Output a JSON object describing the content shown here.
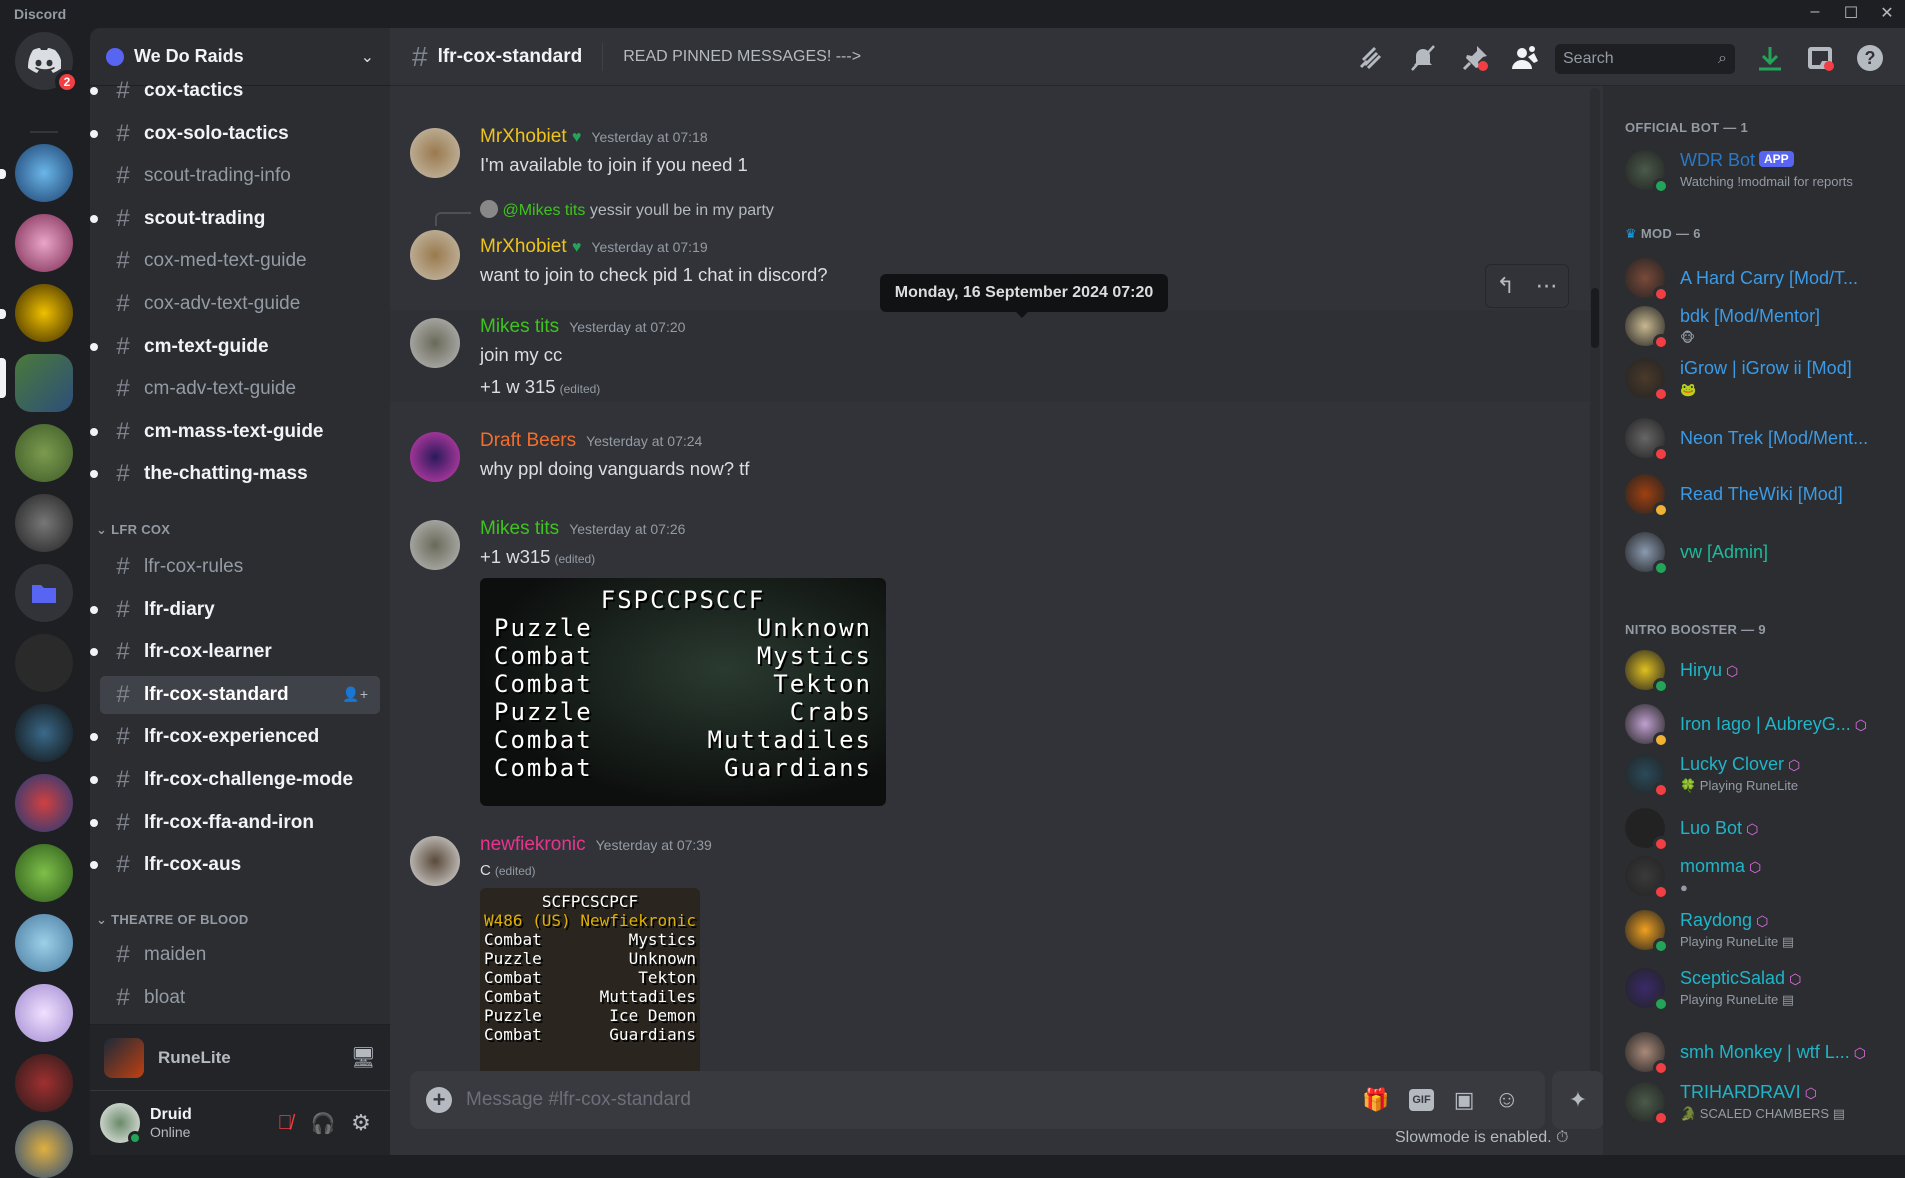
{
  "window": {
    "app_title": "Discord",
    "minimize": "–",
    "maximize": "☐",
    "close": "✕"
  },
  "rail": {
    "home_badge": "2"
  },
  "server": {
    "name": "We Do Raids"
  },
  "channels": [
    {
      "name": "cox-tactics",
      "state": "unread"
    },
    {
      "name": "cox-solo-tactics",
      "state": "unread"
    },
    {
      "name": "scout-trading-info",
      "state": "muted"
    },
    {
      "name": "scout-trading",
      "state": "unread"
    },
    {
      "name": "cox-med-text-guide",
      "state": "muted"
    },
    {
      "name": "cox-adv-text-guide",
      "state": "muted"
    },
    {
      "name": "cm-text-guide",
      "state": "unread"
    },
    {
      "name": "cm-adv-text-guide",
      "state": "muted"
    },
    {
      "name": "cm-mass-text-guide",
      "state": "unread"
    },
    {
      "name": "the-chatting-mass",
      "state": "unread"
    }
  ],
  "categories": {
    "lfr_cox": "LFR COX",
    "tob": "THEATRE OF BLOOD"
  },
  "lfr_channels": [
    {
      "name": "lfr-cox-rules"
    },
    {
      "name": "lfr-diary"
    },
    {
      "name": "lfr-cox-learner"
    },
    {
      "name": "lfr-cox-standard"
    },
    {
      "name": "lfr-cox-experienced"
    },
    {
      "name": "lfr-cox-challenge-mode"
    },
    {
      "name": "lfr-cox-ffa-and-iron"
    },
    {
      "name": "lfr-cox-aus"
    }
  ],
  "tob_channels": [
    {
      "name": "maiden"
    },
    {
      "name": "bloat"
    }
  ],
  "activity": {
    "name": "RuneLite"
  },
  "user": {
    "name": "Druid",
    "status": "Online"
  },
  "header": {
    "channel": "lfr-cox-standard",
    "topic": "READ PINNED MESSAGES! --->",
    "search_placeholder": "Search"
  },
  "messages": [
    {
      "author": "MrXhobiet",
      "color": "#f0c419",
      "time": "Yesterday at 07:18",
      "text": "I'm available to join if you need 1"
    },
    {
      "reply_to": "@Mikes tits",
      "reply_text": "yessir youll be in my party",
      "author": "MrXhobiet",
      "color": "#f0c419",
      "time": "Yesterday at 07:19",
      "text": "want to join to check pid 1 chat in discord?"
    },
    {
      "author": "Mikes tits",
      "color": "#3ec41c",
      "time": "Yesterday at 07:20",
      "text": "join my cc",
      "text2": "+1 w 315",
      "edited": "(edited)"
    },
    {
      "author": "Draft Beers",
      "color": "#f26f2b",
      "time": "Yesterday at 07:24",
      "text": "why ppl doing vanguards now? tf"
    },
    {
      "author": "Mikes tits",
      "color": "#3ec41c",
      "time": "Yesterday at 07:26",
      "text": "+1 w315",
      "edited": "(edited)"
    },
    {
      "author": "newfiekronic",
      "color": "#e9348f",
      "time": "Yesterday at 07:39",
      "text": "C",
      "edited": "(edited)"
    }
  ],
  "tooltip": "Monday, 16 September 2024 07:20",
  "scout1": {
    "title": "FSPCCPSCCF",
    "rows": [
      [
        "Puzzle",
        "Unknown"
      ],
      [
        "Combat",
        "Mystics"
      ],
      [
        "Combat",
        "Tekton"
      ],
      [
        "Puzzle",
        "Crabs"
      ],
      [
        "Combat",
        "Muttadiles"
      ],
      [
        "Combat",
        "Guardians"
      ]
    ]
  },
  "scout2": {
    "title": "SCFPCSCPCF",
    "world": "W486 (US)",
    "player": "Newfiekronic",
    "rows": [
      [
        "Combat",
        "Mystics"
      ],
      [
        "Puzzle",
        "Unknown"
      ],
      [
        "Combat",
        "Tekton"
      ],
      [
        "Combat",
        "Muttadiles"
      ],
      [
        "Puzzle",
        "Ice Demon"
      ],
      [
        "Combat",
        "Guardians"
      ]
    ]
  },
  "composer": {
    "placeholder": "Message #lfr-cox-standard",
    "slowmode": "Slowmode is enabled."
  },
  "members": {
    "cat_bot": "OFFICIAL BOT — 1",
    "cat_mod": "MOD — 6",
    "cat_nitro": "NITRO BOOSTER — 9",
    "bot": [
      {
        "name": "WDR Bot",
        "tag": "APP",
        "sub": "Watching !modmail for reports",
        "color": "#2b78c5",
        "status": "on"
      }
    ],
    "mods": [
      {
        "name": "A Hard Carry [Mod/T...",
        "color": "#3b9be6",
        "status": "dnd",
        "sub": ""
      },
      {
        "name": "bdk [Mod/Mentor]",
        "color": "#3b9be6",
        "status": "dnd",
        "sub": "🐵"
      },
      {
        "name": "iGrow | iGrow ii [Mod]",
        "color": "#3b9be6",
        "status": "dnd",
        "sub": "🐸"
      },
      {
        "name": "Neon Trek [Mod/Ment...",
        "color": "#3b9be6",
        "status": "dnd",
        "sub": ""
      },
      {
        "name": "Read TheWiki [Mod]",
        "color": "#3b9be6",
        "status": "idle",
        "sub": ""
      },
      {
        "name": "vw [Admin]",
        "color": "#1abc9c",
        "status": "on",
        "sub": ""
      }
    ],
    "nitro": [
      {
        "name": "Hiryu",
        "status": "on",
        "sub": ""
      },
      {
        "name": "Iron Iago | AubreyG...",
        "status": "idle",
        "sub": ""
      },
      {
        "name": "Lucky Clover",
        "status": "dnd",
        "sub": "🍀 Playing RuneLite"
      },
      {
        "name": "Luo Bot",
        "status": "dnd",
        "sub": ""
      },
      {
        "name": "momma",
        "status": "dnd",
        "sub": "●"
      },
      {
        "name": "Raydong",
        "status": "on",
        "sub": "Playing RuneLite ▤"
      },
      {
        "name": "ScepticSalad",
        "status": "on",
        "sub": "Playing RuneLite ▤"
      },
      {
        "name": "smh Monkey | wtf L...",
        "status": "dnd",
        "sub": ""
      },
      {
        "name": "TRIHARDRAVI",
        "status": "dnd",
        "sub": "🐊 SCALED CHAMBERS ▤"
      }
    ],
    "nitro_color": "#1fb5c9"
  }
}
